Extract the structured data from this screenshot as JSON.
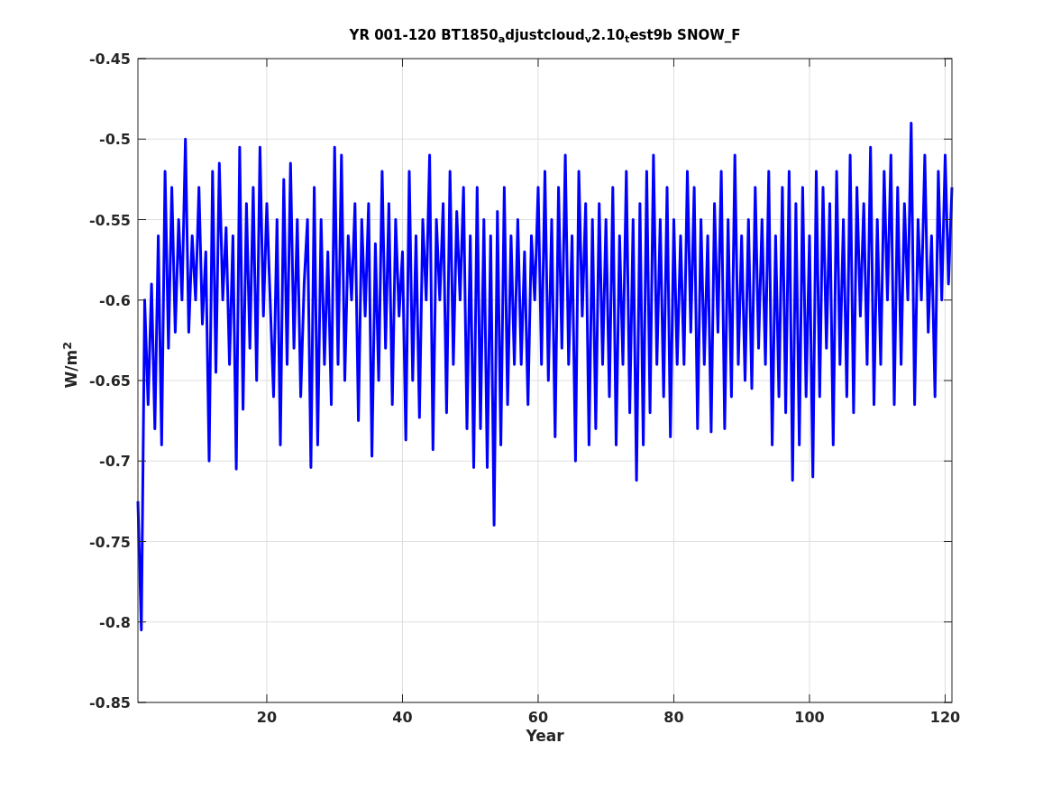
{
  "figure": {
    "chart_data": {
      "type": "line",
      "title": "YR 001-120 BT1850$_{a}$djustcloud$_{v}$2.10$_{t}$est9b SNOW_F",
      "xlabel": "Year",
      "ylabel": "W/m$^{2}$",
      "grid": true,
      "x": [
        1,
        1.5,
        2,
        2.5,
        3,
        3.5,
        4,
        4.5,
        5,
        5.5,
        6,
        6.5,
        7,
        7.5,
        8,
        8.5,
        9,
        9.5,
        10,
        10.5,
        11,
        11.5,
        12,
        12.5,
        13,
        13.5,
        14,
        14.5,
        15,
        15.5,
        16,
        16.5,
        17,
        17.5,
        18,
        18.5,
        19,
        19.5,
        20,
        20.5,
        21,
        21.5,
        22,
        22.5,
        23,
        23.5,
        24,
        24.5,
        25,
        25.5,
        26,
        26.5,
        27,
        27.5,
        28,
        28.5,
        29,
        29.5,
        30,
        30.5,
        31,
        31.5,
        32,
        32.5,
        33,
        33.5,
        34,
        34.5,
        35,
        35.5,
        36,
        36.5,
        37,
        37.5,
        38,
        38.5,
        39,
        39.5,
        40,
        40.5,
        41,
        41.5,
        42,
        42.5,
        43,
        43.5,
        44,
        44.5,
        45,
        45.5,
        46,
        46.5,
        47,
        47.5,
        48,
        48.5,
        49,
        49.5,
        50,
        50.5,
        51,
        51.5,
        52,
        52.5,
        53,
        53.5,
        54,
        54.5,
        55,
        55.5,
        56,
        56.5,
        57,
        57.5,
        58,
        58.5,
        59,
        59.5,
        60,
        60.5,
        61,
        61.5,
        62,
        62.5,
        63,
        63.5,
        64,
        64.5,
        65,
        65.5,
        66,
        66.5,
        67,
        67.5,
        68,
        68.5,
        69,
        69.5,
        70,
        70.5,
        71,
        71.5,
        72,
        72.5,
        73,
        73.5,
        74,
        74.5,
        75,
        75.5,
        76,
        76.5,
        77,
        77.5,
        78,
        78.5,
        79,
        79.5,
        80,
        80.5,
        81,
        81.5,
        82,
        82.5,
        83,
        83.5,
        84,
        84.5,
        85,
        85.5,
        86,
        86.5,
        87,
        87.5,
        88,
        88.5,
        89,
        89.5,
        90,
        90.5,
        91,
        91.5,
        92,
        92.5,
        93,
        93.5,
        94,
        94.5,
        95,
        95.5,
        96,
        96.5,
        97,
        97.5,
        98,
        98.5,
        99,
        99.5,
        100,
        100.5,
        101,
        101.5,
        102,
        102.5,
        103,
        103.5,
        104,
        104.5,
        105,
        105.5,
        106,
        106.5,
        107,
        107.5,
        108,
        108.5,
        109,
        109.5,
        110,
        110.5,
        111,
        111.5,
        112,
        112.5,
        113,
        113.5,
        114,
        114.5,
        115,
        115.5,
        116,
        116.5,
        117,
        117.5,
        118,
        118.5,
        119,
        119.5,
        120,
        120.5,
        121
      ],
      "xlim": [
        1,
        121
      ],
      "ylim": [
        -0.85,
        -0.45
      ],
      "xticks": [
        20,
        40,
        60,
        80,
        100,
        120
      ],
      "yticks": [
        -0.85,
        -0.8,
        -0.75,
        -0.7,
        -0.65,
        -0.6,
        -0.55,
        -0.5,
        -0.45
      ],
      "series": [
        {
          "color": "#0000ff",
          "values": [
            -0.725,
            -0.805,
            -0.6,
            -0.665,
            -0.59,
            -0.68,
            -0.56,
            -0.69,
            -0.52,
            -0.63,
            -0.53,
            -0.62,
            -0.55,
            -0.6,
            -0.5,
            -0.62,
            -0.56,
            -0.6,
            -0.53,
            -0.615,
            -0.57,
            -0.7,
            -0.52,
            -0.645,
            -0.515,
            -0.6,
            -0.555,
            -0.64,
            -0.56,
            -0.705,
            -0.505,
            -0.668,
            -0.54,
            -0.63,
            -0.53,
            -0.65,
            -0.505,
            -0.61,
            -0.54,
            -0.6,
            -0.66,
            -0.55,
            -0.69,
            -0.525,
            -0.64,
            -0.515,
            -0.63,
            -0.55,
            -0.66,
            -0.59,
            -0.55,
            -0.704,
            -0.53,
            -0.69,
            -0.55,
            -0.64,
            -0.57,
            -0.665,
            -0.505,
            -0.64,
            -0.51,
            -0.65,
            -0.56,
            -0.6,
            -0.54,
            -0.675,
            -0.55,
            -0.61,
            -0.54,
            -0.697,
            -0.565,
            -0.65,
            -0.52,
            -0.63,
            -0.54,
            -0.665,
            -0.55,
            -0.61,
            -0.57,
            -0.687,
            -0.52,
            -0.65,
            -0.56,
            -0.673,
            -0.55,
            -0.6,
            -0.51,
            -0.693,
            -0.55,
            -0.6,
            -0.54,
            -0.67,
            -0.52,
            -0.64,
            -0.545,
            -0.6,
            -0.53,
            -0.68,
            -0.56,
            -0.704,
            -0.53,
            -0.68,
            -0.55,
            -0.704,
            -0.56,
            -0.74,
            -0.545,
            -0.69,
            -0.53,
            -0.665,
            -0.56,
            -0.64,
            -0.55,
            -0.64,
            -0.57,
            -0.665,
            -0.56,
            -0.6,
            -0.53,
            -0.64,
            -0.52,
            -0.65,
            -0.55,
            -0.685,
            -0.53,
            -0.63,
            -0.51,
            -0.64,
            -0.56,
            -0.7,
            -0.52,
            -0.61,
            -0.54,
            -0.69,
            -0.55,
            -0.68,
            -0.54,
            -0.64,
            -0.55,
            -0.66,
            -0.53,
            -0.69,
            -0.56,
            -0.64,
            -0.52,
            -0.67,
            -0.55,
            -0.712,
            -0.54,
            -0.69,
            -0.52,
            -0.67,
            -0.51,
            -0.64,
            -0.55,
            -0.66,
            -0.53,
            -0.685,
            -0.55,
            -0.64,
            -0.56,
            -0.64,
            -0.52,
            -0.62,
            -0.53,
            -0.68,
            -0.55,
            -0.64,
            -0.56,
            -0.682,
            -0.54,
            -0.62,
            -0.52,
            -0.68,
            -0.55,
            -0.66,
            -0.51,
            -0.64,
            -0.56,
            -0.65,
            -0.55,
            -0.655,
            -0.53,
            -0.63,
            -0.55,
            -0.64,
            -0.52,
            -0.69,
            -0.56,
            -0.66,
            -0.53,
            -0.67,
            -0.52,
            -0.712,
            -0.54,
            -0.69,
            -0.53,
            -0.66,
            -0.56,
            -0.71,
            -0.52,
            -0.66,
            -0.53,
            -0.63,
            -0.54,
            -0.69,
            -0.52,
            -0.64,
            -0.55,
            -0.66,
            -0.51,
            -0.67,
            -0.53,
            -0.61,
            -0.54,
            -0.64,
            -0.505,
            -0.665,
            -0.55,
            -0.64,
            -0.52,
            -0.6,
            -0.51,
            -0.665,
            -0.53,
            -0.64,
            -0.54,
            -0.6,
            -0.49,
            -0.665,
            -0.55,
            -0.6,
            -0.51,
            -0.62,
            -0.56,
            -0.66,
            -0.52,
            -0.6,
            -0.51,
            -0.59,
            -0.53
          ]
        }
      ]
    }
  }
}
